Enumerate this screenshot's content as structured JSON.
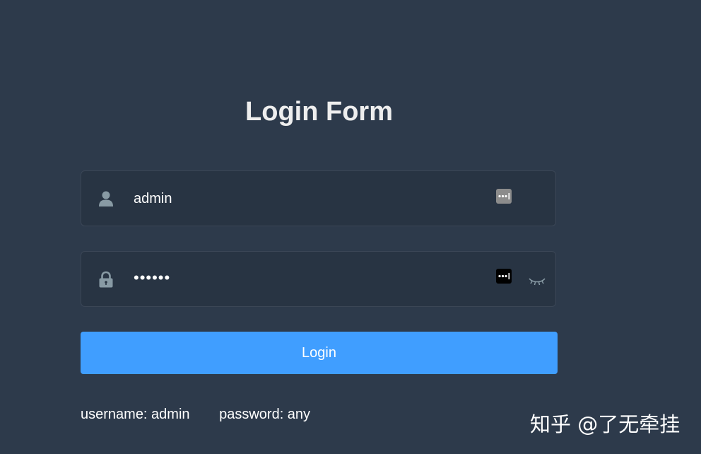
{
  "page": {
    "title": "Login Form",
    "background_color": "#2d3a4b"
  },
  "form": {
    "username": {
      "icon": "user-icon",
      "value": "admin",
      "password_manager_icon": "password-manager-icon"
    },
    "password": {
      "icon": "lock-icon",
      "masked_value": "••••••",
      "password_manager_icon": "password-manager-icon",
      "toggle_icon": "eye-closed-icon"
    },
    "login_button": {
      "label": "Login",
      "color": "#409eff"
    }
  },
  "tips": {
    "username": "username: admin",
    "password": "password: any"
  },
  "watermark": {
    "text": "知乎 @了无牵挂"
  }
}
